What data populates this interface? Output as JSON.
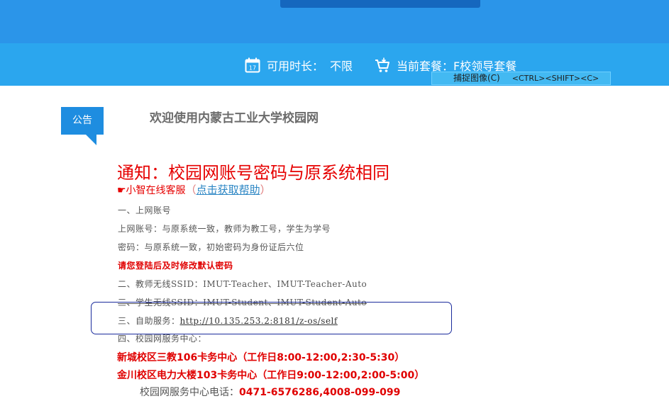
{
  "header": {
    "usage_label": "可用时长：",
    "usage_value": "不限",
    "plan_label": "当前套餐：",
    "plan_value": "F校领导套餐",
    "calendar_day": "17"
  },
  "capture_tip": {
    "label": "捕捉图像(C)",
    "shortcut": "<CTRL><SHIFT><C>"
  },
  "notice": {
    "tag": "公告",
    "welcome": "欢迎使用内蒙古工业大学校园网",
    "headline": "通知：校园网账号密码与原系统相同",
    "cs_prefix": "☛小智在线客服",
    "cs_open": "（",
    "cs_link": "点击获取帮助",
    "cs_close": "）",
    "lines": [
      "一、上网账号",
      "上网账号：与原系统一致，教师为教工号，学生为学号",
      "密码：与原系统一致，初始密码为身份证后六位",
      "请您登陆后及时修改默认密码",
      "二、教师无线SSID：IMUT-Teacher、IMUT-Teacher-Auto",
      "三、学生无线SSID：IMUT-Student、IMUT-Student-Auto",
      "三、自助服务：",
      "四、校园网服务中心："
    ],
    "self_service_url": "http://10.135.253.2:8181/z-os/self",
    "centers": [
      "新城校区三教106卡务中心（工作日8:00-12:00,2:30-5:30）",
      "金川校区电力大楼103卡务中心（工作日9:00-12:00,2:00-5:00）"
    ],
    "phone_label": "校园网服务中心电话：",
    "phone_value": "0471-6576286,4008-099-099"
  },
  "colors": {
    "header_blue": "#2b95e9",
    "info_bar_blue": "#2ba6ee",
    "tag_blue": "#1e8de0",
    "alert_red": "#e60000",
    "link_blue": "#2c86c4"
  }
}
